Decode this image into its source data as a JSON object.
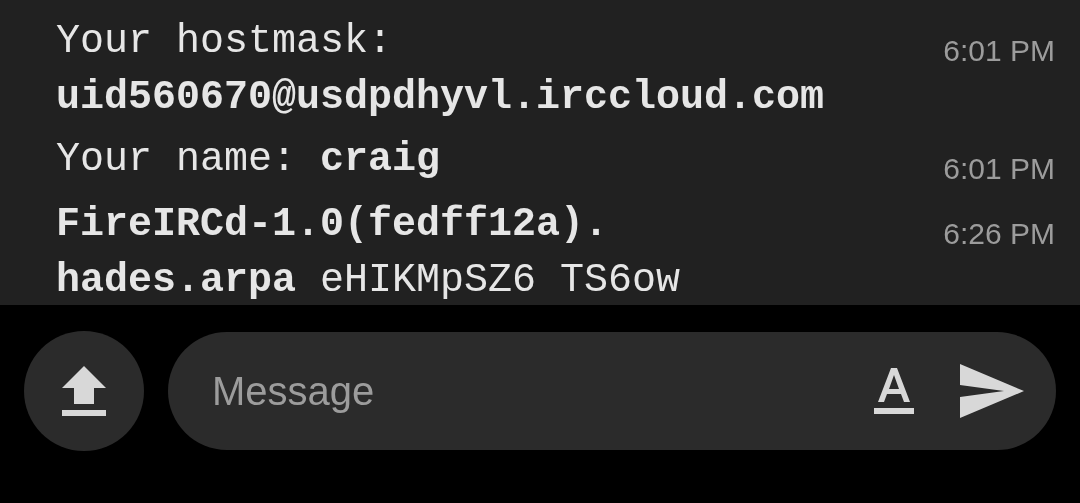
{
  "messages": [
    {
      "text": "Your hostmask:\n**uid560670@usdpdhyvl.irccloud.com**",
      "time": "6:01 PM"
    },
    {
      "text": "Your name: **craig**",
      "time": "6:01 PM"
    },
    {
      "text": "**FireIRCd-1.0(fedff12a).**\n**hades.arpa** eHIKMpSZ6 TS6ow",
      "time": "6:26 PM"
    }
  ],
  "composer": {
    "placeholder": "Message"
  }
}
